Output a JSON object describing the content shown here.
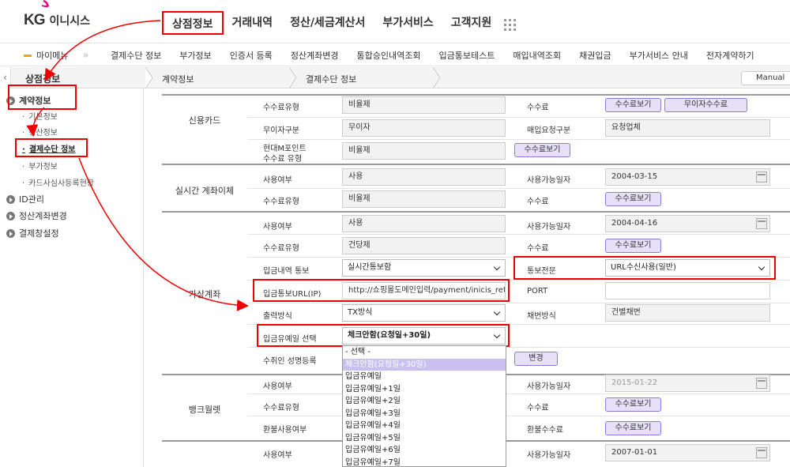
{
  "header": {
    "logo_kg": "KG",
    "logo_name": "이니시스",
    "gnb": [
      "상점정보",
      "거래내역",
      "정산/세금계산서",
      "부가서비스",
      "고객지원"
    ]
  },
  "subnav": {
    "mymenu": "마이메뉴",
    "items": [
      "결제수단 정보",
      "부가정보",
      "인증서 등록",
      "정산계좌변경",
      "통합승인내역조회",
      "입금통보테스트",
      "매입내역조회",
      "채권입금",
      "부가서비스 안내",
      "전자계약하기"
    ]
  },
  "crumb": {
    "home": "상점정보",
    "level1": "계약정보",
    "level2": "결제수단 정보",
    "manual": "Manual"
  },
  "sidebar": {
    "items": [
      "계약정보",
      "ID관리",
      "정산계좌변경",
      "결제창설정"
    ],
    "subs": [
      "기본정보",
      "정산정보",
      "결제수단 정보",
      "부가정보",
      "카드사심사등록현황"
    ]
  },
  "sections": {
    "card": {
      "label": "신용카드",
      "fee_type_label": "수수료유형",
      "fee_type": "비율제",
      "fee_label": "수수료",
      "fee_btn": "수수료보기",
      "free_fee_btn": "무이자수수료",
      "nointerest_label": "무이자구분",
      "nointerest": "무이자",
      "purchase_label": "매입요청구분",
      "purchase": "요청업체",
      "hyundai_label1": "현대M포인트",
      "hyundai_label2": "수수료 유형",
      "hyundai": "비율제",
      "hyundai_btn": "수수료보기"
    },
    "realtime": {
      "label": "실시간 계좌이체",
      "use_label": "사용여부",
      "use": "사용",
      "date_label": "사용가능일자",
      "date": "2004-03-15",
      "fee_type_label": "수수료유형",
      "fee_type": "비율제",
      "fee_label": "수수료",
      "fee_btn": "수수료보기"
    },
    "vaccount": {
      "label": "가상계좌",
      "use_label": "사용여부",
      "use": "사용",
      "date_label": "사용가능일자",
      "date": "2004-04-16",
      "fee_type_label": "수수료유형",
      "fee_type": "건당제",
      "fee_label": "수수료",
      "fee_btn": "수수료보기",
      "notify_label": "입금내역 통보",
      "notify": "실시간통보함",
      "msg_label": "통보전문",
      "msg": "URL수신사용(일반)",
      "url_label": "입금통보URL(IP)",
      "url": "http://쇼핑몰도메인입력/payment/inicis_retu",
      "port_label": "PORT",
      "print_label": "출력방식",
      "print": "TX방식",
      "numbering_label": "채번방식",
      "numbering": "건별채번",
      "grace_label": "입금유예일 선택",
      "grace": "체크안함(요청일+30일)",
      "receiver_label": "수취인 성명등록",
      "change_btn": "변경"
    },
    "bank": {
      "label": "뱅크월렛",
      "use_label": "사용여부",
      "date_label": "사용가능일자",
      "date": "2015-01-22",
      "fee_type_label": "수수료유형",
      "fee_label": "수수료",
      "fee_btn": "수수료보기",
      "refund_label": "환불사용여부",
      "refund_fee_label": "환불수수료",
      "refund_fee_btn": "수수료보기"
    },
    "next": {
      "use_label": "사용여부",
      "date_label": "사용가능일자",
      "date": "2007-01-01"
    }
  },
  "dropdown": {
    "options": [
      "- 선택 -",
      "체크안함(요청일+30일)",
      "입금유예일",
      "입금유예일+1일",
      "입금유예일+2일",
      "입금유예일+3일",
      "입금유예일+4일",
      "입금유예일+5일",
      "입금유예일+6일",
      "입금유예일+7일"
    ]
  },
  "colors": {
    "highlight": "#ee0000",
    "button_bg": "#e6e0f8",
    "button_border": "#8a7bd8",
    "accent": "#e6007e"
  }
}
